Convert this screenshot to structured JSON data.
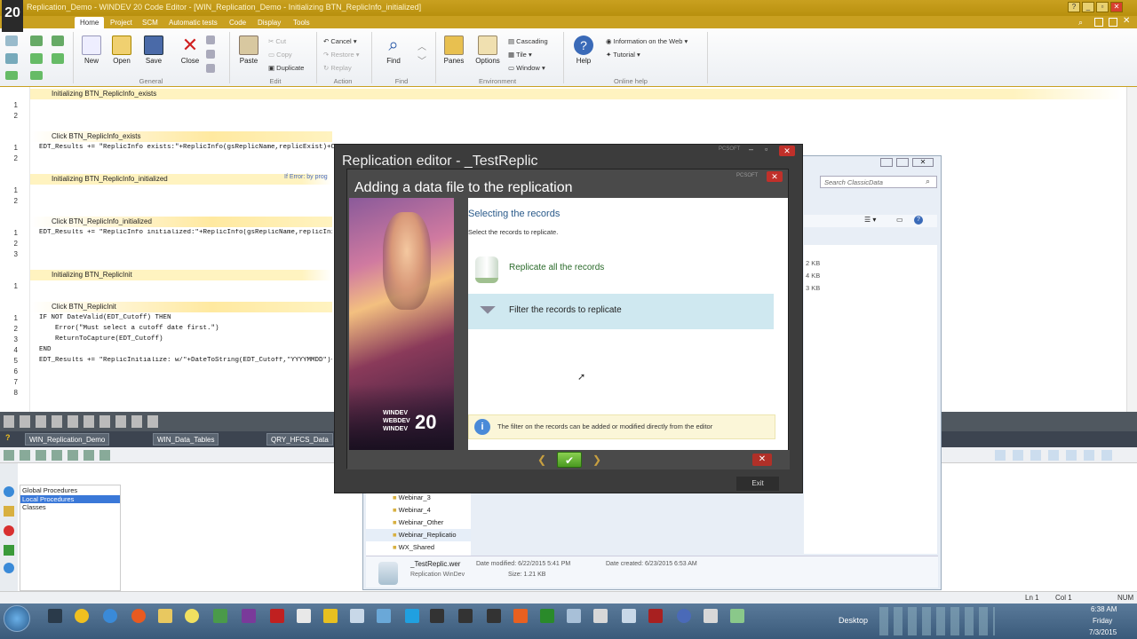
{
  "app": {
    "title": "Replication_Demo - WINDEV 20  Code Editor - [WIN_Replication_Demo - Initializing BTN_ReplicInfo_initialized]",
    "version_badge": "20"
  },
  "menu_tabs": [
    "Home",
    "Project",
    "SCM",
    "Automatic tests",
    "Code",
    "Display",
    "Tools"
  ],
  "ribbon": {
    "general": {
      "new": "New",
      "open": "Open",
      "save": "Save",
      "close": "Close",
      "group": "General"
    },
    "edit": {
      "paste": "Paste",
      "cut": "Cut",
      "copy": "Copy",
      "duplicate": "Duplicate",
      "group": "Edit"
    },
    "action": {
      "cancel": "Cancel",
      "restore": "Restore",
      "replay": "Replay",
      "group": "Action"
    },
    "find": {
      "find": "Find",
      "group": "Find"
    },
    "environment": {
      "panes": "Panes",
      "options": "Options",
      "cascading": "Cascading",
      "tile": "Tile",
      "window": "Window",
      "group": "Environment"
    },
    "online_help": {
      "help": "Help",
      "info_web": "Information on the Web",
      "tutorial": "Tutorial",
      "group": "Online help"
    }
  },
  "code_sections": [
    {
      "header": "Initializing BTN_ReplicInfo_exists",
      "lines": [
        "1",
        "2"
      ],
      "code": []
    },
    {
      "header": "Click BTN_ReplicInfo_exists",
      "lines": [
        "1",
        "2"
      ],
      "code": [
        "EDT_Results += \"ReplicInfo exists:\"+ReplicInfo(gsReplicName,replicExist)+CR"
      ]
    },
    {
      "header": "Initializing BTN_ReplicInfo_initialized",
      "lines": [
        "1",
        "2"
      ],
      "code": [],
      "note": "If Error: by prog"
    },
    {
      "header": "Click BTN_ReplicInfo_initialized",
      "lines": [
        "1",
        "2",
        "3"
      ],
      "code": [
        "EDT_Results += \"ReplicInfo initialized:\"+ReplicInfo(gsReplicName,replicInitia"
      ]
    },
    {
      "header": "Initializing BTN_ReplicInit",
      "lines": [
        "1"
      ],
      "code": []
    },
    {
      "header": "Click BTN_ReplicInit",
      "lines": [
        "1",
        "2",
        "3",
        "4",
        "5",
        "6",
        "7",
        "8"
      ],
      "code": [
        "IF NOT DateValid(EDT_Cutoff) THEN",
        "Error(\"Must select a cutoff date first.\")",
        "ReturnToCapture(EDT_Cutoff)",
        "END",
        "EDT_Results += \"ReplicInitialize: w/\"+DateToString(EDT_Cutoff,\"YYYYMMDD\")+"
      ]
    }
  ],
  "file_tabs": [
    "WIN_Replication_Demo",
    "WIN_Data_Tables",
    "QRY_HFCS_Data"
  ],
  "procedures": [
    "Global Procedures",
    "Local Procedures",
    "Classes"
  ],
  "replication_editor": {
    "title": "Replication editor - _TestReplic",
    "exit_label": "Exit",
    "brand": "PCSOFT"
  },
  "add_dialog": {
    "title": "Adding a data file to the replication",
    "heading": "Selecting the records",
    "instruction": "Select the records to replicate.",
    "option_all": "Replicate all the records",
    "option_filter": "Filter the records to replicate",
    "info_text": "The filter on the records can be added or modified directly from the editor",
    "image_caption_1": "WINDEV",
    "image_caption_2": "WEBDEV",
    "image_caption_3": "WINDEV",
    "image_badge": "20"
  },
  "explorer": {
    "search_placeholder": "Search ClassicData",
    "sizes": [
      "2 KB",
      "4 KB",
      "3 KB"
    ],
    "folders": [
      "Webinar_3",
      "Webinar_4",
      "Webinar_Other",
      "Webinar_Replicatio",
      "WX_Shared"
    ],
    "file_name": "_TestReplic.wer",
    "file_type": "Replication WinDev",
    "date_modified": "Date modified: 6/22/2015 5:41 PM",
    "date_created": "Date created: 6/23/2015 6:53 AM",
    "size": "Size: 1.21 KB"
  },
  "status": {
    "ln": "Ln 1",
    "col": "Col 1",
    "num": "NUM"
  },
  "taskbar": {
    "desktop": "Desktop",
    "time": "6:38 AM",
    "day": "Friday",
    "date": "7/3/2015"
  }
}
